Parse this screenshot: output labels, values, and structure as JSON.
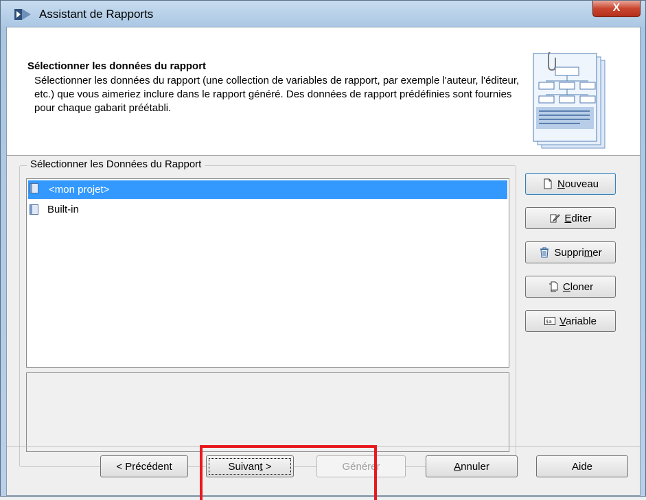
{
  "window": {
    "title": "Assistant de Rapports",
    "close_label": "X"
  },
  "header": {
    "title": "Sélectionner les données du rapport",
    "description": "Sélectionner les données du rapport (une collection de variables de rapport, par exemple l'auteur, l'éditeur, etc.) que vous aimeriez inclure dans le rapport généré. Des données de rapport prédéfinies sont fournies pour chaque gabarit préétabli."
  },
  "group": {
    "label": "Sélectionner les Données du Rapport",
    "items": [
      {
        "label": "<mon projet>",
        "selected": true
      },
      {
        "label": "Built-in",
        "selected": false
      }
    ]
  },
  "side_buttons": {
    "nouveau": {
      "pre": "",
      "mn": "N",
      "post": "ouveau",
      "icon": "new-document-icon"
    },
    "editer": {
      "pre": "",
      "mn": "E",
      "post": "diter",
      "icon": "edit-icon"
    },
    "supprimer": {
      "pre": "Suppri",
      "mn": "m",
      "post": "er",
      "icon": "trash-icon"
    },
    "cloner": {
      "pre": "",
      "mn": "C",
      "post": "loner",
      "icon": "clone-icon"
    },
    "variable": {
      "pre": "",
      "mn": "V",
      "post": "ariable",
      "icon": "variable-icon"
    }
  },
  "footer": {
    "precedent": "< Précédent",
    "suivant_pre": "Suivan",
    "suivant_mn": "t",
    "suivant_post": " >",
    "generer": "Générer",
    "annuler_mn": "A",
    "annuler_post": "nnuler",
    "aide": "Aide"
  },
  "colors": {
    "selection": "#3399ff",
    "highlight": "#e8191e"
  }
}
